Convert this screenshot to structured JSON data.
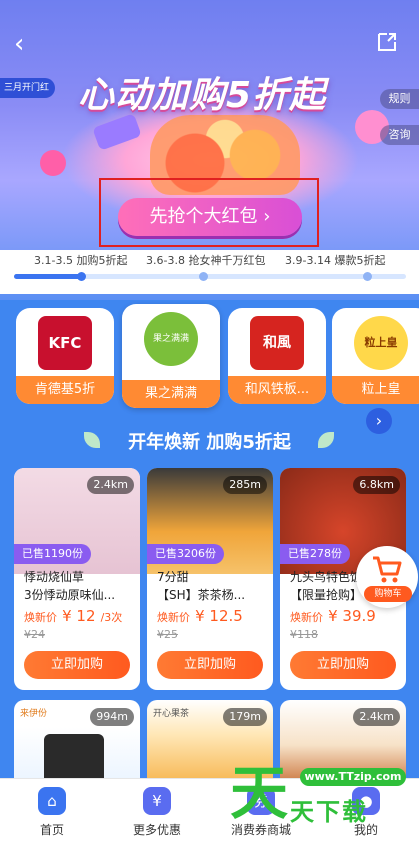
{
  "hero": {
    "back_glyph": "‹",
    "tag_left": "三月开门红",
    "rules": "规则",
    "consult": "咨询",
    "title": "心动加购5折起",
    "grab_button": "先抢个大红包 ›"
  },
  "phases": {
    "items": [
      "3.1-3.5 加购5折起",
      "3.6-3.8 抢女神千万红包",
      "3.9-3.14 爆款5折起"
    ],
    "progress": 0.17
  },
  "brands": [
    {
      "label": "肯德基5折"
    },
    {
      "label": "果之满满"
    },
    {
      "label": "和风铁板..."
    },
    {
      "label": "粒上皇"
    }
  ],
  "brand_logo_text": [
    "KFC",
    "果之满满",
    "和風",
    "粒上皇"
  ],
  "section": {
    "title": "开年焕新 加购5折起"
  },
  "products": [
    {
      "distance": "2.4km",
      "sold": "已售1190份",
      "name": "悸动烧仙草",
      "desc": "3份悸动原味仙...",
      "price_label": "焕新价",
      "price": "¥ 12",
      "unit": "/3次",
      "orig": "¥24",
      "buy": "立即加购"
    },
    {
      "distance": "285m",
      "sold": "已售3206份",
      "name": "7分甜",
      "desc": "【SH】茶茶杨...",
      "price_label": "焕新价",
      "price": "¥ 12.5",
      "unit": "",
      "orig": "¥25",
      "buy": "立即加购"
    },
    {
      "distance": "6.8km",
      "sold": "已售278份",
      "name": "九头鸟特色饭",
      "desc": "【限量抢购】",
      "price_label": "焕新价",
      "price": "¥ 39.9",
      "unit": "",
      "orig": "¥118",
      "buy": "立即加购"
    }
  ],
  "products_row2": [
    {
      "distance": "994m",
      "brand_text": "来伊份"
    },
    {
      "distance": "179m",
      "brand_text": "开心果茶"
    },
    {
      "distance": "2.4km",
      "brand_text": ""
    }
  ],
  "cart": {
    "label": "购物车"
  },
  "tabs": [
    {
      "label": "首页",
      "icon": "home-icon"
    },
    {
      "label": "更多优惠",
      "icon": "discount-icon"
    },
    {
      "label": "消费券商城",
      "icon": "coupon-icon"
    },
    {
      "label": "我的",
      "icon": "user-icon"
    }
  ],
  "watermark": {
    "site": "www.TTzip.com",
    "big": "天",
    "cn": "天下载"
  },
  "colors": {
    "accent": "#3b74f0",
    "price": "#ff5a1f",
    "buy": "#ff5a1f",
    "sold": "#8a5cf0"
  }
}
